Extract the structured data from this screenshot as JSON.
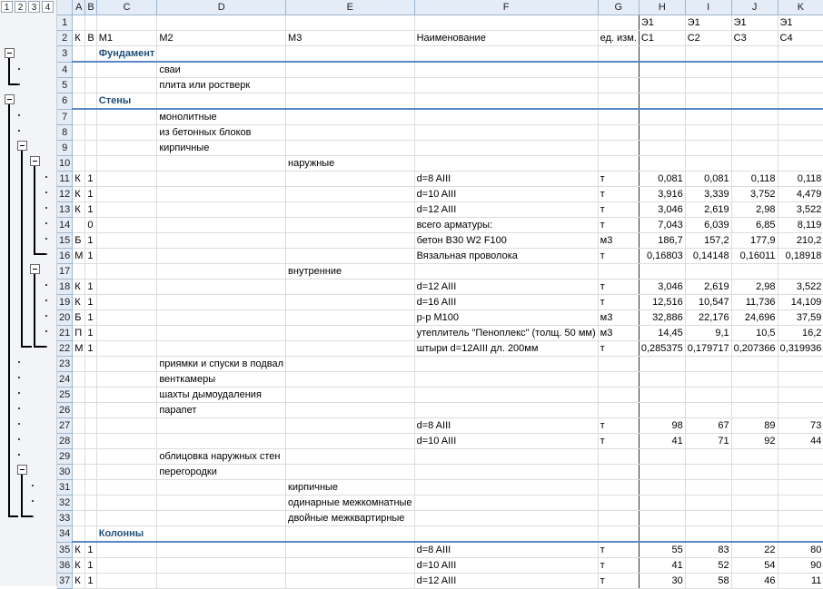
{
  "outline_levels": [
    "1",
    "2",
    "3",
    "4"
  ],
  "columns": [
    "A",
    "B",
    "C",
    "D",
    "E",
    "F",
    "G",
    "H",
    "I",
    "J",
    "K"
  ],
  "rows": [
    {
      "n": "1",
      "h": "Э1",
      "i": "Э1",
      "j": "Э1",
      "k": "Э1"
    },
    {
      "n": "2",
      "a": "К",
      "b": "В",
      "c": "М1",
      "d": "М2",
      "e": "М3",
      "f": "Наименование",
      "g": "ед. изм.",
      "h": "С1",
      "i": "С2",
      "j": "С3",
      "k": "С4"
    },
    {
      "n": "3",
      "c": "Фундамент",
      "section": true
    },
    {
      "n": "4",
      "d": "сваи"
    },
    {
      "n": "5",
      "d": "плита или ростверк"
    },
    {
      "n": "6",
      "c": "Стены",
      "section": true
    },
    {
      "n": "7",
      "d": "монолитные"
    },
    {
      "n": "8",
      "d": "из бетонных блоков"
    },
    {
      "n": "9",
      "d": "кирпичные"
    },
    {
      "n": "10",
      "e": "наружные"
    },
    {
      "n": "11",
      "a": "К",
      "b": "1",
      "f": "d=8 AIII",
      "g": "т",
      "h": "0,081",
      "i": "0,081",
      "j": "0,118",
      "k": "0,118"
    },
    {
      "n": "12",
      "a": "К",
      "b": "1",
      "f": "d=10 AIII",
      "g": "т",
      "h": "3,916",
      "i": "3,339",
      "j": "3,752",
      "k": "4,479"
    },
    {
      "n": "13",
      "a": "К",
      "b": "1",
      "f": "d=12 AIII",
      "g": "т",
      "h": "3,046",
      "i": "2,619",
      "j": "2,98",
      "k": "3,522"
    },
    {
      "n": "14",
      "b": "0",
      "f": "всего арматуры:",
      "g": "т",
      "h": "7,043",
      "i": "6,039",
      "j": "6,85",
      "k": "8,119"
    },
    {
      "n": "15",
      "a": "Б",
      "b": "1",
      "f": "бетон В30 W2 F100",
      "g": "м3",
      "h": "186,7",
      "i": "157,2",
      "j": "177,9",
      "k": "210,2"
    },
    {
      "n": "16",
      "a": "М",
      "b": "1",
      "f": "Вязальная проволока",
      "g": "т",
      "h": "0,16803",
      "i": "0,14148",
      "j": "0,16011",
      "k": "0,18918"
    },
    {
      "n": "17",
      "e": "внутренние"
    },
    {
      "n": "18",
      "a": "К",
      "b": "1",
      "f": "d=12 AIII",
      "g": "т",
      "h": "3,046",
      "i": "2,619",
      "j": "2,98",
      "k": "3,522"
    },
    {
      "n": "19",
      "a": "К",
      "b": "1",
      "f": "d=16 AIII",
      "g": "т",
      "h": "12,516",
      "i": "10,547",
      "j": "11,736",
      "k": "14,109"
    },
    {
      "n": "20",
      "a": "Б",
      "b": "1",
      "f": "р-р М100",
      "g": "м3",
      "h": "32,886",
      "i": "22,176",
      "j": "24,696",
      "k": "37,59"
    },
    {
      "n": "21",
      "a": "П",
      "b": "1",
      "f": "утеплитель \"Пеноплекс\" (толщ. 50 мм)",
      "g": "м3",
      "h": "14,45",
      "i": "9,1",
      "j": "10,5",
      "k": "16,2"
    },
    {
      "n": "22",
      "a": "М",
      "b": "1",
      "f": "штыри d=12AIII дл. 200мм",
      "g": "т",
      "h": "0,285375",
      "i": "0,179717",
      "j": "0,207366",
      "k": "0,319936"
    },
    {
      "n": "23",
      "d": "приямки и спуски в подвал"
    },
    {
      "n": "24",
      "d": "венткамеры"
    },
    {
      "n": "25",
      "d": "шахты дымоудаления"
    },
    {
      "n": "26",
      "d": "парапет"
    },
    {
      "n": "27",
      "f": "d=8 AIII",
      "g": "т",
      "h": "98",
      "i": "67",
      "j": "89",
      "k": "73"
    },
    {
      "n": "28",
      "f": "d=10 AIII",
      "g": "т",
      "h": "41",
      "i": "71",
      "j": "92",
      "k": "44"
    },
    {
      "n": "29",
      "d": "облицовка наружных стен"
    },
    {
      "n": "30",
      "d": "перегородки"
    },
    {
      "n": "31",
      "e": "кирпичные"
    },
    {
      "n": "32",
      "e": "одинарные межкомнатные"
    },
    {
      "n": "33",
      "e": "двойные межквартирные"
    },
    {
      "n": "34",
      "c": "Колонны",
      "section": true
    },
    {
      "n": "35",
      "a": "К",
      "b": "1",
      "f": "d=8 AIII",
      "g": "т",
      "h": "55",
      "i": "83",
      "j": "22",
      "k": "80"
    },
    {
      "n": "36",
      "a": "К",
      "b": "1",
      "f": "d=10 AIII",
      "g": "т",
      "h": "41",
      "i": "52",
      "j": "54",
      "k": "90"
    },
    {
      "n": "37",
      "a": "К",
      "b": "1",
      "f": "d=12 AIII",
      "g": "т",
      "h": "30",
      "i": "58",
      "j": "46",
      "k": "11"
    }
  ],
  "icons": {
    "collapse": "minus-outline-icon",
    "detail": "dot-icon"
  }
}
